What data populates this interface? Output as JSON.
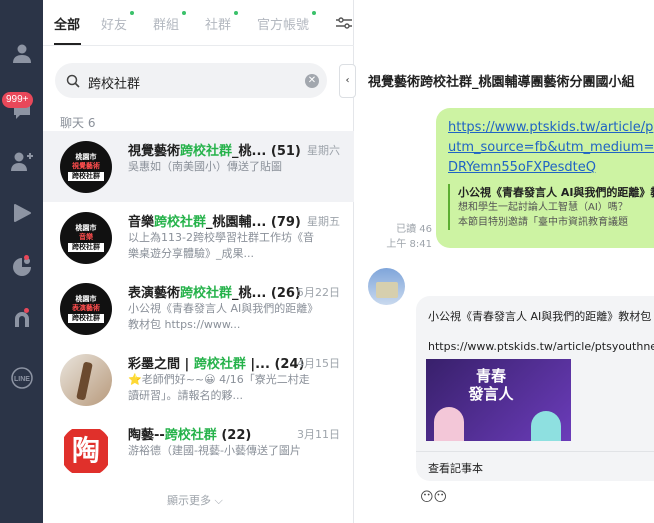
{
  "rail": {
    "badge": "999+"
  },
  "tabs": [
    {
      "label": "全部",
      "active": true
    },
    {
      "label": "好友"
    },
    {
      "label": "群組"
    },
    {
      "label": "社群"
    },
    {
      "label": "官方帳號"
    }
  ],
  "search": {
    "value": "跨校社群"
  },
  "section_label": "聊天 6",
  "chats": [
    {
      "title_pre": "視覺藝術",
      "title_hl": "跨校社群",
      "title_post": "_桃...",
      "count": "(51)",
      "date": "星期六",
      "preview": "吳惠如（南美國小）傳送了貼圖",
      "avatar_lines": [
        "桃園市",
        "視覺藝術",
        "跨校社群"
      ]
    },
    {
      "title_pre": "音樂",
      "title_hl": "跨校社群",
      "title_post": "_桃園輔...",
      "count": "(79)",
      "date": "星期五",
      "preview": "以上為113-2跨校學習社群工作坊《音樂桌遊分享體驗》_成果...",
      "avatar_lines": [
        "桃園市",
        "音樂",
        "跨校社群"
      ]
    },
    {
      "title_pre": "表演藝術",
      "title_hl": "跨校社群",
      "title_post": "_桃...",
      "count": "(26)",
      "date": "5月22日",
      "preview": "小公視《青春發言人 AI與我們的距離》教材包 https://www...",
      "avatar_lines": [
        "桃園市",
        "表演藝術",
        "跨校社群"
      ]
    },
    {
      "title_pre": "彩墨之間 | ",
      "title_hl": "跨校社群",
      "title_post": " |...",
      "count": "(24)",
      "date": "4月15日",
      "preview": "⭐老師們好~~😀 4/16「寮光二村走讀研習」。請報名的夥...",
      "avatar_lines": []
    },
    {
      "title_pre": "陶藝--",
      "title_hl": "跨校社群",
      "title_post": "",
      "count": "(22)",
      "date": "3月11日",
      "preview": "游裕德（建國-視藝-小藝傳送了圖片",
      "avatar_lines": [
        "陶"
      ]
    }
  ],
  "show_more": "顯示更多 ⌵",
  "chat": {
    "title": "視覺藝術跨校社群_桃園輔導團藝術分團國小組",
    "sent_links": [
      "https://www.ptskids.tw/article/p",
      "utm_source=fb&utm_medium=",
      "DRYemn55oFXPesdteQ"
    ],
    "quote_title": "小公視《青春發言人 AI與我們的距離》教",
    "quote_lines": [
      "想和學生一起討論人工智慧（AI）嗎？",
      "本節目特別邀請「臺中市資訊教育議題"
    ],
    "read_status": "已讀 46",
    "sent_time": "上午 8:41",
    "received_line1": "小公視《青春發言人 AI與我們的距離》教材包",
    "received_line2": "https://www.ptskids.tw/article/ptsyouthnew",
    "read_more": "查看記事本",
    "reaction": "😶😶",
    "card_text": "青春 發言人"
  }
}
